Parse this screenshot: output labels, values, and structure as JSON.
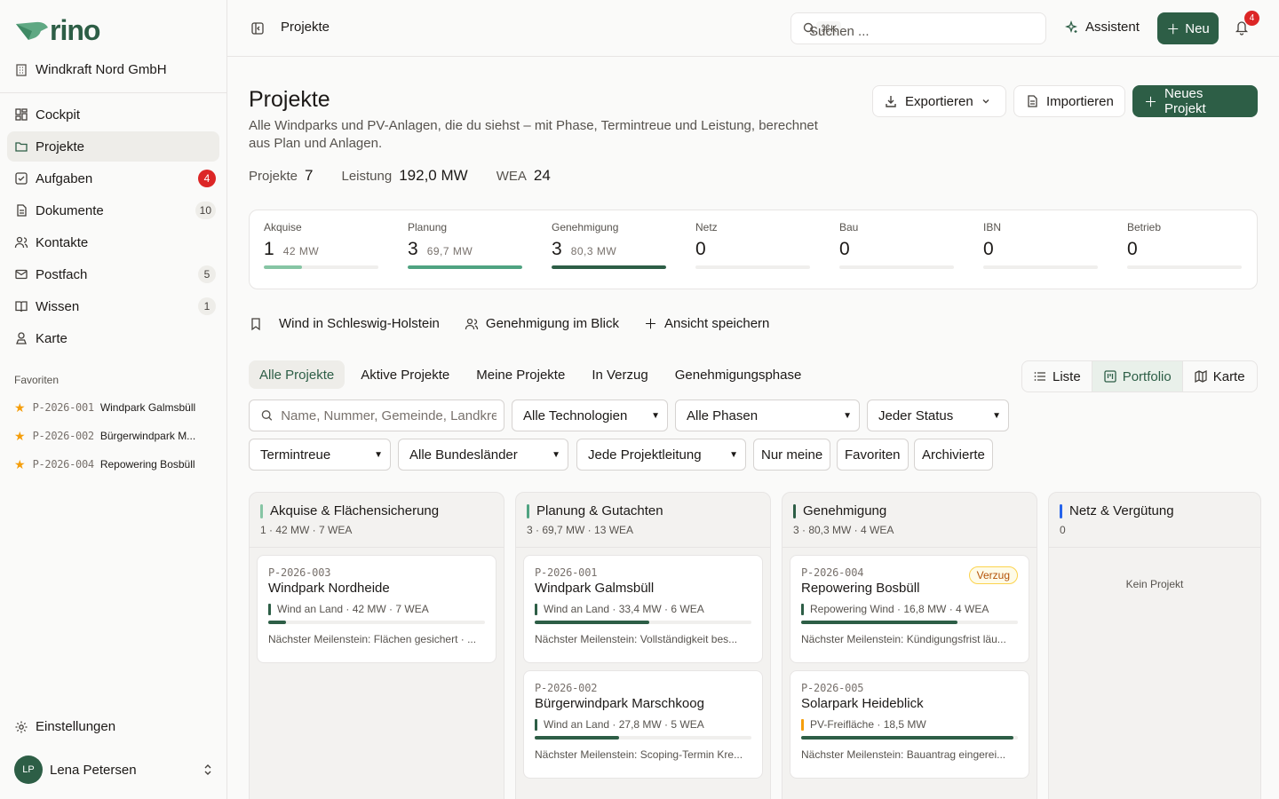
{
  "app": {
    "brand": "rino",
    "org": "Windkraft Nord GmbH"
  },
  "nav": [
    {
      "label": "Cockpit",
      "badge": ""
    },
    {
      "label": "Projekte",
      "badge": ""
    },
    {
      "label": "Aufgaben",
      "badge": "4"
    },
    {
      "label": "Dokumente",
      "badge": "10"
    },
    {
      "label": "Kontakte",
      "badge": ""
    },
    {
      "label": "Postfach",
      "badge": "5"
    },
    {
      "label": "Wissen",
      "badge": "1"
    },
    {
      "label": "Karte",
      "badge": ""
    }
  ],
  "favorites": {
    "heading": "Favoriten",
    "items": [
      {
        "code": "P-2026-001",
        "name": "Windpark Galmsbüll"
      },
      {
        "code": "P-2026-002",
        "name": "Bürgerwindpark M..."
      },
      {
        "code": "P-2026-004",
        "name": "Repowering Bosbüll"
      }
    ]
  },
  "footer": {
    "settings": "Einstellungen",
    "user_initials": "LP",
    "user_name": "Lena Petersen"
  },
  "topbar": {
    "title": "Projekte",
    "search_placeholder": "Suchen ...",
    "shortcut": "⌘K",
    "assistant": "Assistent",
    "new": "Neu",
    "notifications": "4"
  },
  "page": {
    "title": "Projekte",
    "description": "Alle Windparks und PV-Anlagen, die du siehst – mit Phase, Termintreue und Leistung, berechnet aus Plan und Anlagen.",
    "export": "Exportieren",
    "import": "Importieren",
    "new_project": "Neues Projekt",
    "stats": [
      {
        "label": "Projekte",
        "value": "7"
      },
      {
        "label": "Leistung",
        "value": "192,0 MW"
      },
      {
        "label": "WEA",
        "value": "24"
      }
    ]
  },
  "phases": [
    {
      "label": "Akquise",
      "count": "1",
      "mw": "42 MW",
      "fill": 0.33,
      "color": "#86c5a4"
    },
    {
      "label": "Planung",
      "count": "3",
      "mw": "69,7 MW",
      "fill": 1.0,
      "color": "#4fa381"
    },
    {
      "label": "Genehmigung",
      "count": "3",
      "mw": "80,3 MW",
      "fill": 1.0,
      "color": "#2d5e46"
    },
    {
      "label": "Netz",
      "count": "0",
      "mw": "",
      "fill": 0,
      "color": "#2d5e46"
    },
    {
      "label": "Bau",
      "count": "0",
      "mw": "",
      "fill": 0,
      "color": "#2d5e46"
    },
    {
      "label": "IBN",
      "count": "0",
      "mw": "",
      "fill": 0,
      "color": "#2d5e46"
    },
    {
      "label": "Betrieb",
      "count": "0",
      "mw": "",
      "fill": 0,
      "color": "#2d5e46"
    }
  ],
  "saved_views": [
    {
      "label": "Wind in Schleswig-Holstein"
    },
    {
      "label": "Genehmigung im Blick"
    },
    {
      "label": "Ansicht speichern"
    }
  ],
  "tabs": [
    "Alle Projekte",
    "Aktive Projekte",
    "Meine Projekte",
    "In Verzug",
    "Genehmigungsphase"
  ],
  "view_modes": [
    "Liste",
    "Portfolio",
    "Karte"
  ],
  "filters": {
    "search_placeholder": "Name, Nummer, Gemeinde, Landkreis",
    "technology": "Alle Technologien",
    "phase": "Alle Phasen",
    "status": "Jeder Status",
    "schedule": "Termintreue",
    "state": "Alle Bundesländer",
    "lead": "Jede Projektleitung",
    "mine": "Nur meine",
    "favorites": "Favoriten",
    "archived": "Archivierte"
  },
  "columns": [
    {
      "title": "Akquise & Flächensicherung",
      "summary": "1 · 42 MW · 7 WEA",
      "color": "#86c5a4",
      "empty": "",
      "cards": [
        {
          "code": "P-2026-003",
          "name": "Windpark Nordheide",
          "meta": "Wind an Land · 42 MW · 7 WEA",
          "meta_color": "#2d5e46",
          "progress": 0.08,
          "next": "Nächster Meilenstein: Flächen gesichert · ...",
          "tag": ""
        }
      ]
    },
    {
      "title": "Planung & Gutachten",
      "summary": "3 · 69,7 MW · 13 WEA",
      "color": "#4fa381",
      "empty": "",
      "cards": [
        {
          "code": "P-2026-001",
          "name": "Windpark Galmsbüll",
          "meta": "Wind an Land · 33,4 MW · 6 WEA",
          "meta_color": "#2d5e46",
          "progress": 0.53,
          "next": "Nächster Meilenstein: Vollständigkeit bes...",
          "tag": ""
        },
        {
          "code": "P-2026-002",
          "name": "Bürgerwindpark Marschkoog",
          "meta": "Wind an Land · 27,8 MW · 5 WEA",
          "meta_color": "#2d5e46",
          "progress": 0.39,
          "next": "Nächster Meilenstein: Scoping-Termin Kre...",
          "tag": ""
        }
      ]
    },
    {
      "title": "Genehmigung",
      "summary": "3 · 80,3 MW · 4 WEA",
      "color": "#2d5e46",
      "empty": "",
      "cards": [
        {
          "code": "P-2026-004",
          "name": "Repowering Bosbüll",
          "meta": "Repowering Wind · 16,8 MW · 4 WEA",
          "meta_color": "#2d5e46",
          "progress": 0.72,
          "next": "Nächster Meilenstein: Kündigungsfrist läu...",
          "tag": "Verzug"
        },
        {
          "code": "P-2026-005",
          "name": "Solarpark Heideblick",
          "meta": "PV-Freifläche · 18,5 MW",
          "meta_color": "#f59e0b",
          "progress": 0.98,
          "next": "Nächster Meilenstein: Bauantrag eingerei...",
          "tag": ""
        }
      ]
    },
    {
      "title": "Netz & Vergütung",
      "summary": "0",
      "color": "#2563eb",
      "empty": "Kein Projekt",
      "cards": []
    }
  ]
}
